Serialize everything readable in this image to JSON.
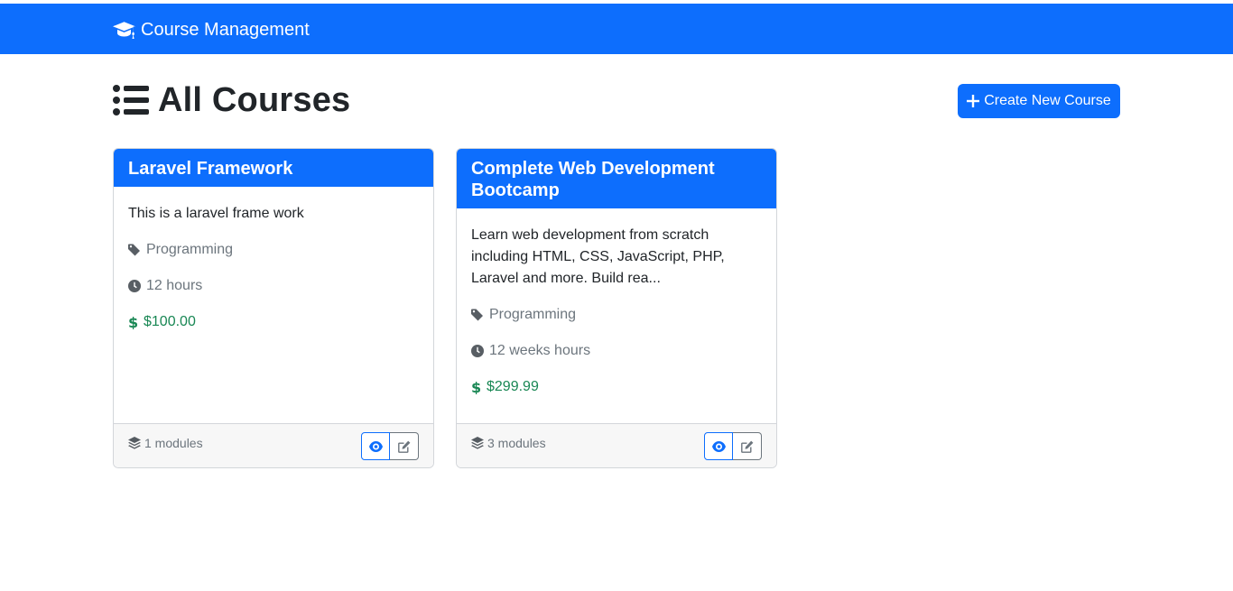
{
  "navbar": {
    "brand": "Course Management",
    "brand_icon": "graduation-cap-icon"
  },
  "page": {
    "title": "All Courses",
    "title_icon": "list-icon"
  },
  "actions": {
    "create_label": "Create New Course"
  },
  "colors": {
    "primary": "#0d6efd",
    "price": "#198754",
    "muted": "#6c757d"
  },
  "courses": [
    {
      "title": "Laravel Framework",
      "description": "This is a laravel frame work",
      "category": "Programming",
      "duration": "12 hours",
      "price": "$100.00",
      "modules": "1 modules"
    },
    {
      "title": "Complete Web Development Bootcamp",
      "description": "Learn web development from scratch including HTML, CSS, JavaScript, PHP, Laravel and more. Build rea...",
      "category": "Programming",
      "duration": "12 weeks hours",
      "price": "$299.99",
      "modules": "3 modules"
    }
  ]
}
